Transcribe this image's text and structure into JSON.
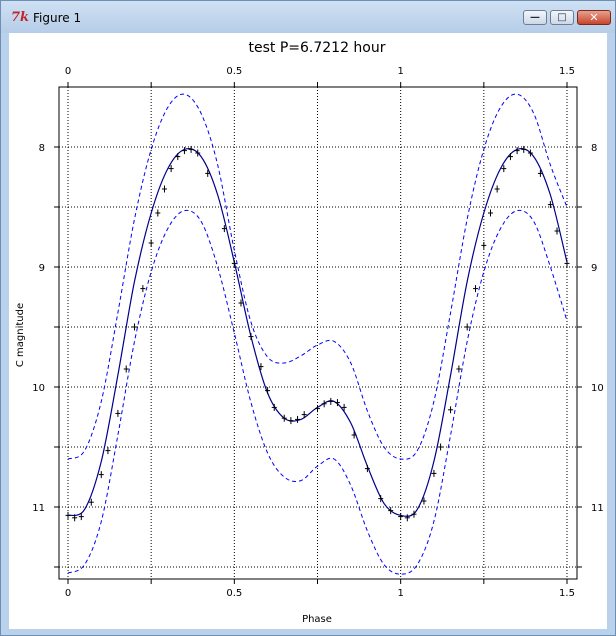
{
  "window": {
    "title": "Figure 1",
    "icon_name": "tk-feather-icon",
    "controls": [
      "minimize-icon",
      "maximize-icon",
      "close-icon"
    ]
  },
  "chart_data": {
    "type": "line",
    "title": "test P=6.7212 hour",
    "xlabel": "Phase",
    "ylabel": "C magnitude",
    "xlim": [
      0,
      1.5
    ],
    "ylim": [
      11.6,
      7.5
    ],
    "y_inverted": true,
    "x_ticks": [
      "0",
      "0.5",
      "1",
      "1.5"
    ],
    "y_ticks": [
      "8",
      "9",
      "10",
      "11"
    ],
    "grid": true,
    "grid_style": "dotted",
    "colors": {
      "fit": "#00008b",
      "band": "#0000ff",
      "data": "#000000"
    },
    "series": [
      {
        "kind": "fit",
        "style": "solid",
        "x": [
          0.0,
          0.05,
          0.1,
          0.15,
          0.2,
          0.25,
          0.3,
          0.35,
          0.4,
          0.45,
          0.5,
          0.55,
          0.6,
          0.65,
          0.7,
          0.75,
          0.8,
          0.85,
          0.9,
          0.95,
          1.0,
          1.05,
          1.1,
          1.15,
          1.2,
          1.25,
          1.3,
          1.35,
          1.4,
          1.45,
          1.5
        ],
        "y": [
          11.07,
          11.02,
          10.62,
          9.9,
          9.12,
          8.55,
          8.18,
          8.02,
          8.08,
          8.4,
          8.96,
          9.58,
          10.05,
          10.26,
          10.27,
          10.17,
          10.12,
          10.3,
          10.66,
          10.97,
          11.07,
          11.02,
          10.62,
          9.9,
          9.12,
          8.55,
          8.18,
          8.02,
          8.08,
          8.4,
          8.96
        ]
      },
      {
        "kind": "upper-band",
        "style": "dashed",
        "x": [
          0.0,
          0.05,
          0.1,
          0.15,
          0.2,
          0.25,
          0.3,
          0.35,
          0.4,
          0.45,
          0.5,
          0.55,
          0.6,
          0.65,
          0.7,
          0.75,
          0.8,
          0.85,
          0.9,
          0.95,
          1.0,
          1.05,
          1.1,
          1.15,
          1.2,
          1.25,
          1.3,
          1.35,
          1.4,
          1.45,
          1.5
        ],
        "y": [
          10.6,
          10.53,
          10.12,
          9.38,
          8.6,
          8.02,
          7.67,
          7.56,
          7.72,
          8.15,
          8.86,
          9.46,
          9.75,
          9.8,
          9.74,
          9.65,
          9.62,
          9.8,
          10.2,
          10.5,
          10.6,
          10.53,
          10.12,
          9.38,
          8.6,
          8.02,
          7.67,
          7.56,
          7.72,
          8.15,
          8.5
        ]
      },
      {
        "kind": "lower-band",
        "style": "dashed",
        "x": [
          0.0,
          0.05,
          0.1,
          0.15,
          0.2,
          0.25,
          0.3,
          0.35,
          0.4,
          0.45,
          0.5,
          0.55,
          0.6,
          0.65,
          0.7,
          0.75,
          0.8,
          0.85,
          0.9,
          0.95,
          1.0,
          1.05,
          1.1,
          1.15,
          1.2,
          1.25,
          1.3,
          1.35,
          1.4,
          1.45,
          1.5
        ],
        "y": [
          11.55,
          11.48,
          11.12,
          10.4,
          9.62,
          9.04,
          8.68,
          8.53,
          8.62,
          9.0,
          9.55,
          10.13,
          10.55,
          10.75,
          10.78,
          10.66,
          10.6,
          10.82,
          11.2,
          11.48,
          11.56,
          11.48,
          11.12,
          10.4,
          9.62,
          9.04,
          8.68,
          8.53,
          8.62,
          9.0,
          9.45
        ]
      },
      {
        "kind": "observations",
        "style": "plus",
        "x": [
          0.0,
          0.02,
          0.04,
          0.07,
          0.1,
          0.12,
          0.15,
          0.175,
          0.2,
          0.225,
          0.25,
          0.27,
          0.29,
          0.31,
          0.33,
          0.35,
          0.37,
          0.39,
          0.42,
          0.47,
          0.5,
          0.52,
          0.55,
          0.58,
          0.6,
          0.62,
          0.65,
          0.67,
          0.69,
          0.71,
          0.75,
          0.77,
          0.79,
          0.81,
          0.83,
          0.86,
          0.9,
          0.94,
          0.97,
          1.0,
          1.02,
          1.04,
          1.07,
          1.1,
          1.12,
          1.15,
          1.175,
          1.2,
          1.225,
          1.25,
          1.27,
          1.29,
          1.31,
          1.33,
          1.35,
          1.37,
          1.39,
          1.42,
          1.45,
          1.47,
          1.5
        ],
        "y": [
          11.07,
          11.09,
          11.08,
          10.96,
          10.73,
          10.53,
          10.22,
          9.85,
          9.5,
          9.18,
          8.8,
          8.55,
          8.35,
          8.18,
          8.08,
          8.03,
          8.02,
          8.05,
          8.22,
          8.68,
          8.97,
          9.3,
          9.58,
          9.83,
          10.03,
          10.17,
          10.26,
          10.28,
          10.27,
          10.23,
          10.18,
          10.14,
          10.12,
          10.13,
          10.17,
          10.4,
          10.68,
          10.93,
          11.03,
          11.08,
          11.09,
          11.06,
          10.95,
          10.72,
          10.5,
          10.19,
          9.85,
          9.5,
          9.18,
          8.82,
          8.55,
          8.35,
          8.18,
          8.08,
          8.03,
          8.02,
          8.05,
          8.22,
          8.48,
          8.7,
          8.97
        ]
      }
    ]
  }
}
